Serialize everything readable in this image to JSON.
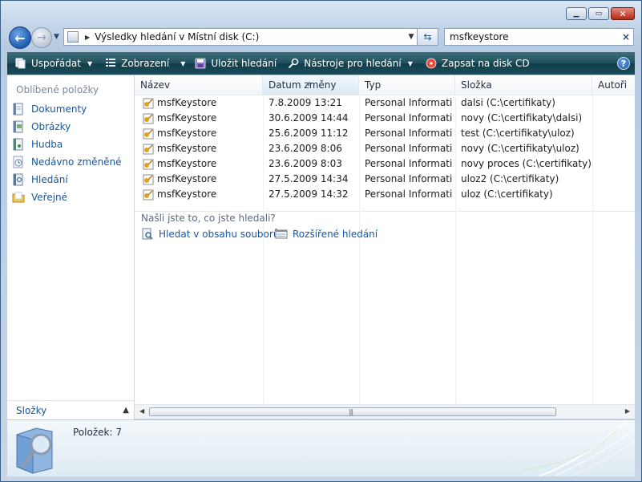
{
  "window": {
    "caption_buttons": [
      "minimize",
      "maximize",
      "close"
    ]
  },
  "nav": {
    "address_path": "Výsledky hledání v Místní disk (C:)",
    "search_value": "msfkeystore",
    "search_clear": "×"
  },
  "toolbar": {
    "organize": "Uspořádat",
    "views": "Zobrazení",
    "save_search": "Uložit hledání",
    "search_tools": "Nástroje pro hledání",
    "burn": "Zapsat na disk CD",
    "help": "?"
  },
  "sidebar": {
    "heading": "Oblíbené položky",
    "items": [
      {
        "label": "Dokumenty",
        "icon": "documents-icon"
      },
      {
        "label": "Obrázky",
        "icon": "pictures-icon"
      },
      {
        "label": "Hudba",
        "icon": "music-icon"
      },
      {
        "label": "Nedávno změněné",
        "icon": "recent-icon"
      },
      {
        "label": "Hledání",
        "icon": "searches-icon"
      },
      {
        "label": "Veřejné",
        "icon": "public-folder-icon"
      }
    ],
    "folders_label": "Složky"
  },
  "columns": [
    "Název",
    "Datum změny",
    "Typ",
    "Složka",
    "Autoři"
  ],
  "files": [
    {
      "name": "msfKeystore",
      "date": "7.8.2009 13:21",
      "type": "Personal Informati...",
      "folder": "dalsi (C:\\certifikaty)"
    },
    {
      "name": "msfKeystore",
      "date": "30.6.2009 14:44",
      "type": "Personal Informati...",
      "folder": "novy (C:\\certifikaty\\dalsi)"
    },
    {
      "name": "msfKeystore",
      "date": "25.6.2009 11:12",
      "type": "Personal Informati...",
      "folder": "test (C:\\certifikaty\\uloz)"
    },
    {
      "name": "msfKeystore",
      "date": "23.6.2009 8:06",
      "type": "Personal Informati...",
      "folder": "novy (C:\\certifikaty\\uloz)"
    },
    {
      "name": "msfKeystore",
      "date": "23.6.2009 8:03",
      "type": "Personal Informati...",
      "folder": "novy proces (C:\\certifikaty)"
    },
    {
      "name": "msfKeystore",
      "date": "27.5.2009 14:34",
      "type": "Personal Informati...",
      "folder": "uloz2 (C:\\certifikaty)"
    },
    {
      "name": "msfKeystore",
      "date": "27.5.2009 14:32",
      "type": "Personal Informati...",
      "folder": "uloz (C:\\certifikaty)"
    }
  ],
  "search_help": {
    "question": "Našli jste to, co jste hledali?",
    "search_contents": "Hledat v obsahu souborů",
    "advanced_search": "Rozšířené hledání"
  },
  "details": {
    "item_count": "Položek: 7"
  },
  "colors": {
    "toolbar": "#1f4f5c",
    "link": "#1558a3",
    "close": "#c0392b"
  }
}
